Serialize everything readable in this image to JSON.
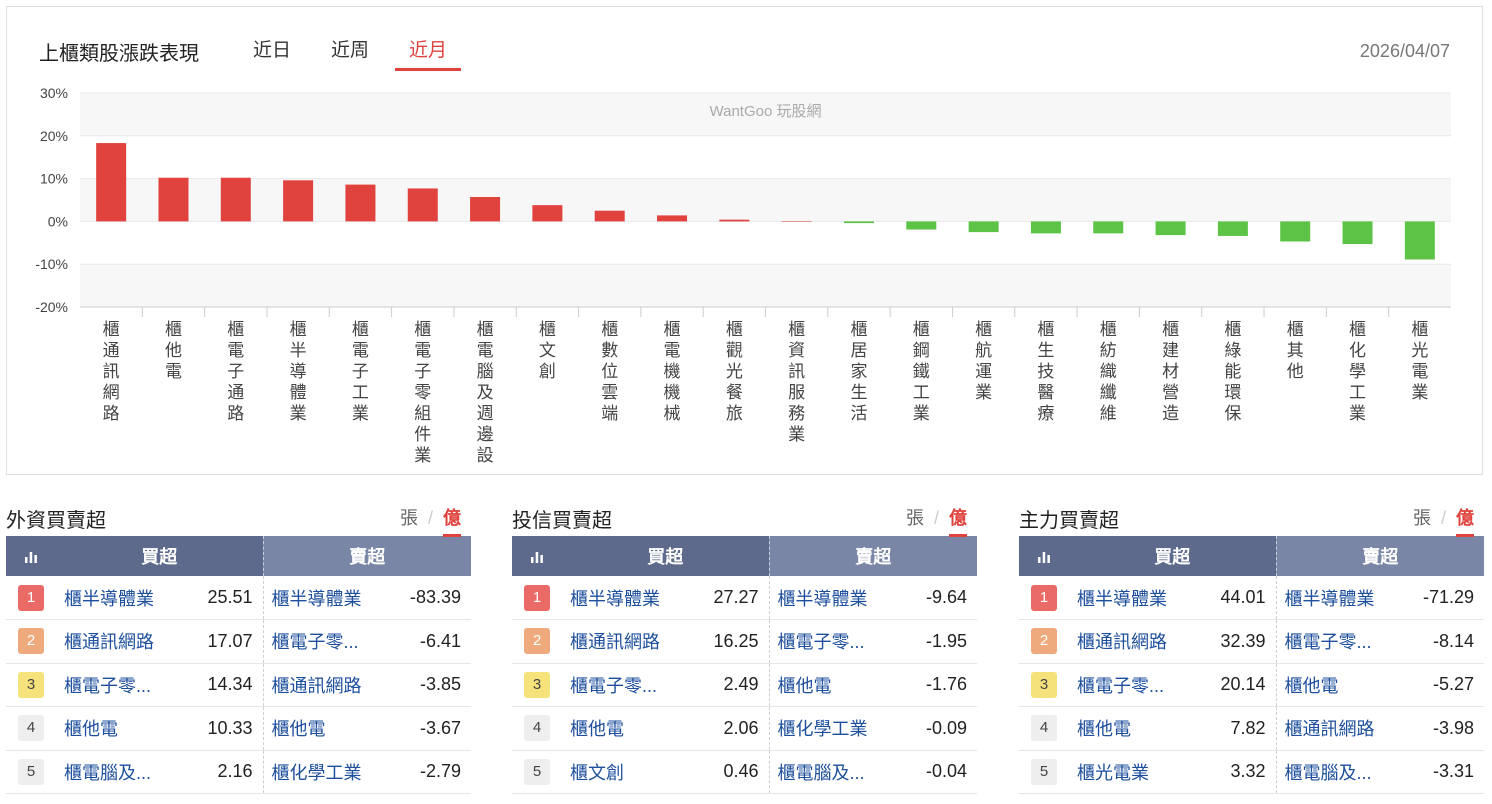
{
  "header": {
    "title": "上櫃類股漲跌表現",
    "tabs": [
      "近日",
      "近周",
      "近月"
    ],
    "active_tab": 2,
    "date": "2026/04/07"
  },
  "colors": {
    "up": "#e0423e",
    "down": "#5cc347",
    "accent": "#e0423e",
    "header_bg": "#5d6a8c",
    "header_bg_sell": "#7a86a5",
    "link": "#1d4f9c"
  },
  "chart_data": {
    "type": "bar",
    "watermark": "WantGoo 玩股網",
    "categories": [
      "櫃通訊網路",
      "櫃他電",
      "櫃電子通路",
      "櫃半導體業",
      "櫃電子工業",
      "櫃電子零組件業",
      "櫃電腦及週邊設",
      "櫃文創",
      "櫃數位雲端",
      "櫃電機機械",
      "櫃觀光餐旅",
      "櫃資訊服務業",
      "櫃居家生活",
      "櫃鋼鐵工業",
      "櫃航運業",
      "櫃生技醫療",
      "櫃紡織纖維",
      "櫃建材營造",
      "櫃綠能環保",
      "櫃其他",
      "櫃化學工業",
      "櫃光電業"
    ],
    "values": [
      18.3,
      10.2,
      10.2,
      9.6,
      8.6,
      7.7,
      5.7,
      3.8,
      2.5,
      1.4,
      0.4,
      0.05,
      -0.4,
      -1.9,
      -2.5,
      -2.8,
      -2.8,
      -3.2,
      -3.4,
      -4.7,
      -5.3,
      -8.9
    ],
    "ylim": [
      -20,
      30
    ],
    "yticks": [
      30,
      20,
      10,
      0,
      -10,
      -20
    ],
    "ytick_labels": [
      "30%",
      "20%",
      "10%",
      "0%",
      "-10%",
      "-20%"
    ],
    "grid": true
  },
  "panels": [
    {
      "title": "外資買賣超",
      "units": [
        "張",
        "億"
      ],
      "active_unit": 1,
      "col_buy": "買超",
      "col_sell": "賣超",
      "rows": [
        {
          "rank": "1",
          "buy_name": "櫃半導體業",
          "buy_val": "25.51",
          "sell_name": "櫃半導體業",
          "sell_val": "-83.39"
        },
        {
          "rank": "2",
          "buy_name": "櫃通訊網路",
          "buy_val": "17.07",
          "sell_name": "櫃電子零...",
          "sell_val": "-6.41"
        },
        {
          "rank": "3",
          "buy_name": "櫃電子零...",
          "buy_val": "14.34",
          "sell_name": "櫃通訊網路",
          "sell_val": "-3.85"
        },
        {
          "rank": "4",
          "buy_name": "櫃他電",
          "buy_val": "10.33",
          "sell_name": "櫃他電",
          "sell_val": "-3.67"
        },
        {
          "rank": "5",
          "buy_name": "櫃電腦及...",
          "buy_val": "2.16",
          "sell_name": "櫃化學工業",
          "sell_val": "-2.79"
        }
      ]
    },
    {
      "title": "投信買賣超",
      "units": [
        "張",
        "億"
      ],
      "active_unit": 1,
      "col_buy": "買超",
      "col_sell": "賣超",
      "rows": [
        {
          "rank": "1",
          "buy_name": "櫃半導體業",
          "buy_val": "27.27",
          "sell_name": "櫃半導體業",
          "sell_val": "-9.64"
        },
        {
          "rank": "2",
          "buy_name": "櫃通訊網路",
          "buy_val": "16.25",
          "sell_name": "櫃電子零...",
          "sell_val": "-1.95"
        },
        {
          "rank": "3",
          "buy_name": "櫃電子零...",
          "buy_val": "2.49",
          "sell_name": "櫃他電",
          "sell_val": "-1.76"
        },
        {
          "rank": "4",
          "buy_name": "櫃他電",
          "buy_val": "2.06",
          "sell_name": "櫃化學工業",
          "sell_val": "-0.09"
        },
        {
          "rank": "5",
          "buy_name": "櫃文創",
          "buy_val": "0.46",
          "sell_name": "櫃電腦及...",
          "sell_val": "-0.04"
        }
      ]
    },
    {
      "title": "主力買賣超",
      "units": [
        "張",
        "億"
      ],
      "active_unit": 1,
      "col_buy": "買超",
      "col_sell": "賣超",
      "rows": [
        {
          "rank": "1",
          "buy_name": "櫃半導體業",
          "buy_val": "44.01",
          "sell_name": "櫃半導體業",
          "sell_val": "-71.29"
        },
        {
          "rank": "2",
          "buy_name": "櫃通訊網路",
          "buy_val": "32.39",
          "sell_name": "櫃電子零...",
          "sell_val": "-8.14"
        },
        {
          "rank": "3",
          "buy_name": "櫃電子零...",
          "buy_val": "20.14",
          "sell_name": "櫃他電",
          "sell_val": "-5.27"
        },
        {
          "rank": "4",
          "buy_name": "櫃他電",
          "buy_val": "7.82",
          "sell_name": "櫃通訊網路",
          "sell_val": "-3.98"
        },
        {
          "rank": "5",
          "buy_name": "櫃光電業",
          "buy_val": "3.32",
          "sell_name": "櫃電腦及...",
          "sell_val": "-3.31"
        }
      ]
    }
  ],
  "rank_colors": [
    "#e96a66",
    "#eea97c",
    "#f6e27a",
    "#eeeeee",
    "#eeeeee"
  ],
  "rank_text_colors": [
    "#ffffff",
    "#ffffff",
    "#444444",
    "#444444",
    "#444444"
  ]
}
